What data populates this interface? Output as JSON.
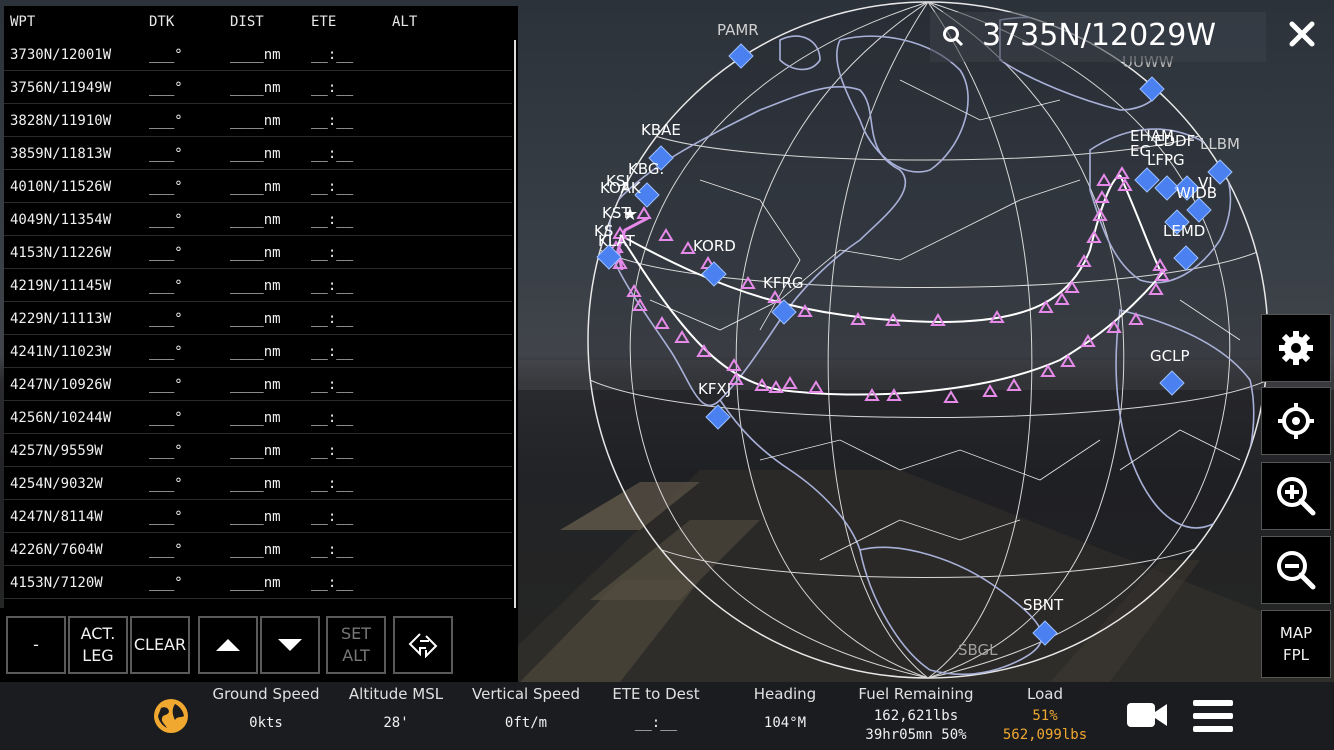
{
  "flight_plan": {
    "headers": {
      "wpt": "WPT",
      "dtk": "DTK",
      "dist": "DIST",
      "ete": "ETE",
      "alt": "ALT"
    },
    "rows": [
      {
        "wpt": "3730N/12001W",
        "dtk": "___°",
        "dist": "____nm",
        "ete": "__:__"
      },
      {
        "wpt": "3756N/11949W",
        "dtk": "___°",
        "dist": "____nm",
        "ete": "__:__"
      },
      {
        "wpt": "3828N/11910W",
        "dtk": "___°",
        "dist": "____nm",
        "ete": "__:__"
      },
      {
        "wpt": "3859N/11813W",
        "dtk": "___°",
        "dist": "____nm",
        "ete": "__:__"
      },
      {
        "wpt": "4010N/11526W",
        "dtk": "___°",
        "dist": "____nm",
        "ete": "__:__"
      },
      {
        "wpt": "4049N/11354W",
        "dtk": "___°",
        "dist": "____nm",
        "ete": "__:__"
      },
      {
        "wpt": "4153N/11226W",
        "dtk": "___°",
        "dist": "____nm",
        "ete": "__:__"
      },
      {
        "wpt": "4219N/11145W",
        "dtk": "___°",
        "dist": "____nm",
        "ete": "__:__"
      },
      {
        "wpt": "4229N/11113W",
        "dtk": "___°",
        "dist": "____nm",
        "ete": "__:__"
      },
      {
        "wpt": "4241N/11023W",
        "dtk": "___°",
        "dist": "____nm",
        "ete": "__:__"
      },
      {
        "wpt": "4247N/10926W",
        "dtk": "___°",
        "dist": "____nm",
        "ete": "__:__"
      },
      {
        "wpt": "4256N/10244W",
        "dtk": "___°",
        "dist": "____nm",
        "ete": "__:__"
      },
      {
        "wpt": "4257N/9559W",
        "dtk": "___°",
        "dist": "____nm",
        "ete": "__:__"
      },
      {
        "wpt": "4254N/9032W",
        "dtk": "___°",
        "dist": "____nm",
        "ete": "__:__"
      },
      {
        "wpt": "4247N/8114W",
        "dtk": "___°",
        "dist": "____nm",
        "ete": "__:__"
      },
      {
        "wpt": "4226N/7604W",
        "dtk": "___°",
        "dist": "____nm",
        "ete": "__:__"
      },
      {
        "wpt": "4153N/7120W",
        "dtk": "___°",
        "dist": "____nm",
        "ete": "__:__"
      }
    ]
  },
  "buttons": {
    "minus": "-",
    "act_leg_1": "ACT.",
    "act_leg_2": "LEG",
    "clear": "CLEAR",
    "set_alt_1": "SET",
    "set_alt_2": "ALT"
  },
  "search": {
    "value": "3735N/12029W"
  },
  "map_fpl": {
    "line1": "MAP",
    "line2": "FPL"
  },
  "map_labels": [
    "PAMR",
    "KBAE",
    "KBG.",
    "KSJ",
    "KOAK",
    "KST",
    "KS",
    "KLAT",
    "KORD",
    "KFRG",
    "KFXJ",
    "EHAM",
    "EG.",
    "LFPG",
    "EDDF",
    "LLBM",
    "LEMD",
    "GCLP",
    "SBNT",
    "SBGL",
    "UUWW",
    "VI",
    "WIDB"
  ],
  "status": {
    "ground_speed": {
      "label": "Ground Speed",
      "value": "0kts"
    },
    "altitude": {
      "label": "Altitude MSL",
      "value": "28'"
    },
    "vertical_speed": {
      "label": "Vertical Speed",
      "value": "0ft/m"
    },
    "ete_dest": {
      "label": "ETE to Dest",
      "value": "__:__"
    },
    "heading": {
      "label": "Heading",
      "value": "104°M"
    },
    "fuel": {
      "label": "Fuel Remaining",
      "value1": "162,621lbs",
      "value2": "39hr05mn 50%"
    },
    "load": {
      "label": "Load",
      "value1": "51%",
      "value2": "562,099lbs"
    }
  },
  "colors": {
    "accent": "#f0a830",
    "route": "#e58ae8",
    "waypoint": "#4a80f0",
    "panel": "#000000"
  }
}
